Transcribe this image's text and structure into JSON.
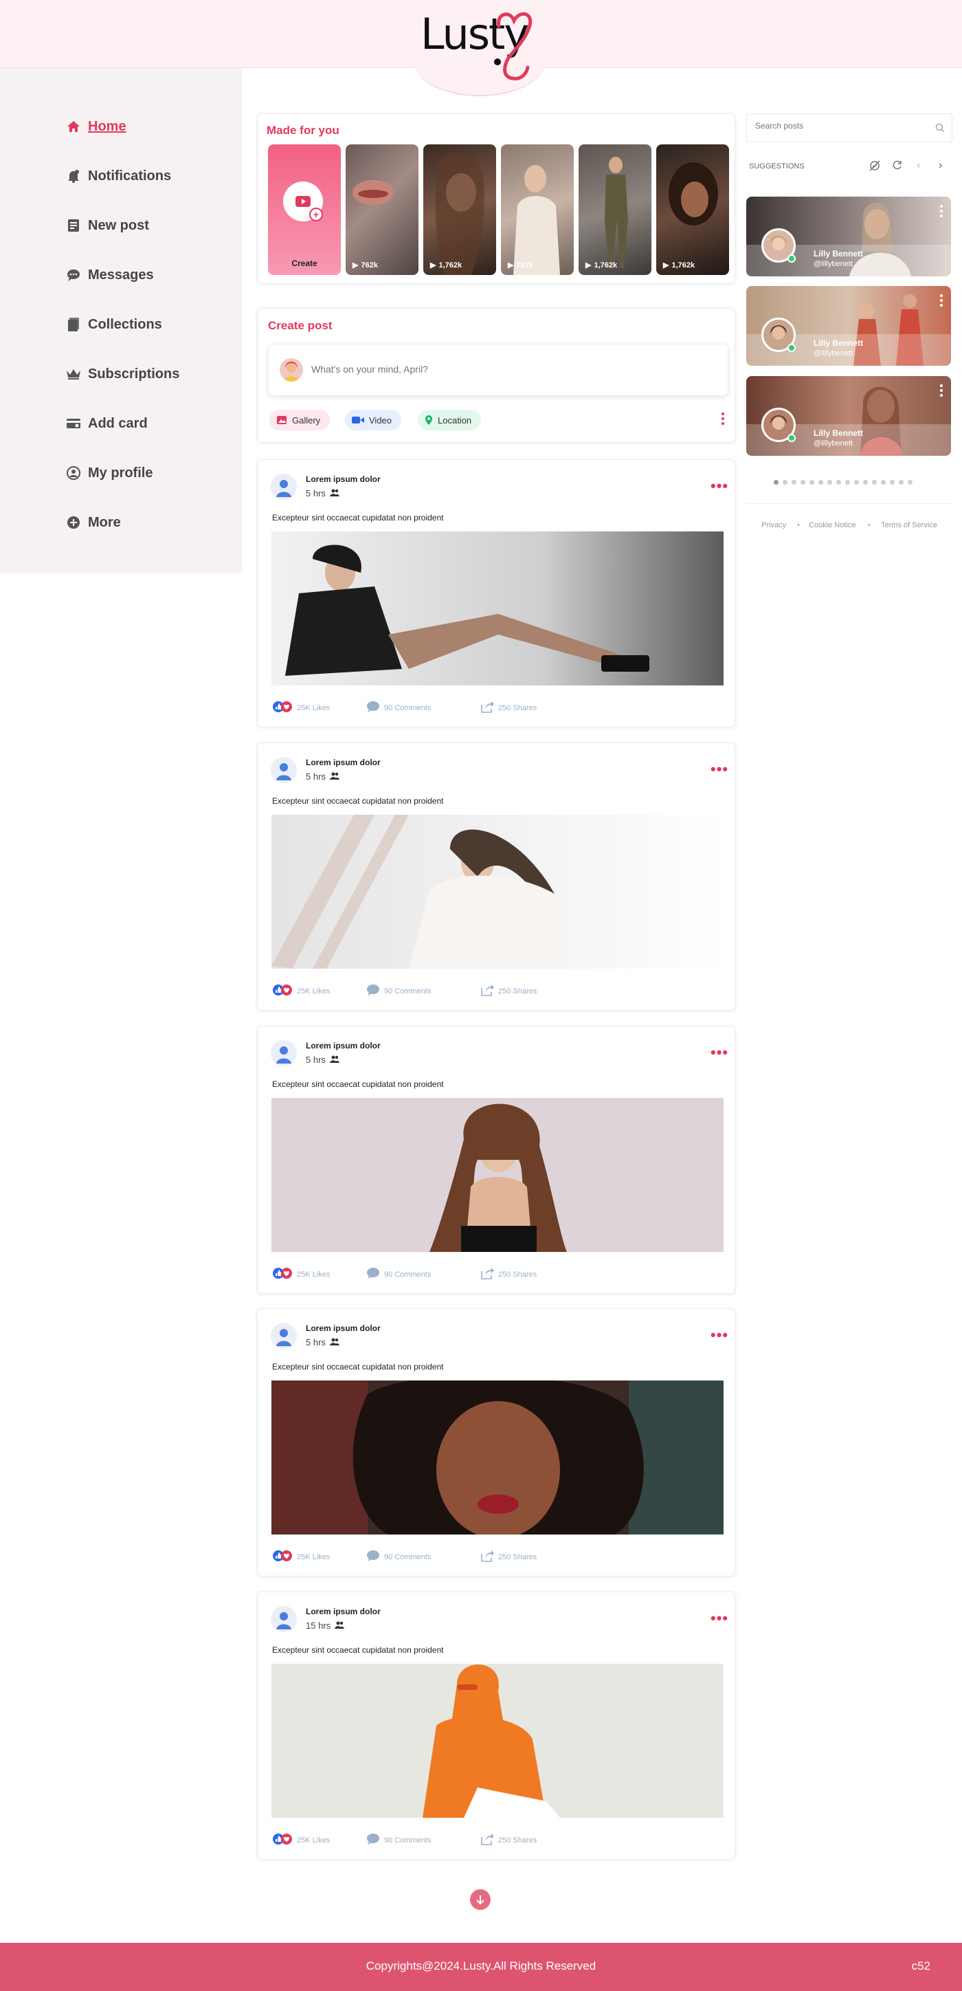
{
  "app": {
    "logo_text": "Lusty"
  },
  "sidebar": {
    "items": [
      {
        "label": "Home",
        "icon": "home-icon",
        "active": true
      },
      {
        "label": "Notifications",
        "icon": "bell-icon"
      },
      {
        "label": "New post",
        "icon": "new-post-icon"
      },
      {
        "label": "Messages",
        "icon": "chat-icon"
      },
      {
        "label": "Collections",
        "icon": "collections-icon"
      },
      {
        "label": "Subscriptions",
        "icon": "crown-icon"
      },
      {
        "label": "Add card",
        "icon": "card-icon"
      },
      {
        "label": "My profile",
        "icon": "profile-icon"
      },
      {
        "label": "More",
        "icon": "more-icon"
      }
    ]
  },
  "stories": {
    "title": "Made for you",
    "create_label": "Create",
    "items": [
      {
        "count": "762k"
      },
      {
        "count": "1,762k"
      },
      {
        "count": "762k"
      },
      {
        "count": "1,762k"
      },
      {
        "count": "1,762k"
      }
    ]
  },
  "create_post": {
    "title": "Create post",
    "placeholder": "What's on your mind, April?",
    "chips": [
      {
        "label": "Gallery",
        "icon": "gallery-icon"
      },
      {
        "label": "Video",
        "icon": "video-icon"
      },
      {
        "label": "Location",
        "icon": "location-icon"
      }
    ]
  },
  "posts": [
    {
      "author": "Lorem ipsum dolor",
      "time": "5 hrs",
      "text": "Excepteur sint occaecat cupidatat non proident",
      "likes": "25K Likes",
      "comments": "90 Comments",
      "shares": "250 Shares"
    },
    {
      "author": "Lorem ipsum dolor",
      "time": "5 hrs",
      "text": "Excepteur sint occaecat cupidatat non proident",
      "likes": "25K Likes",
      "comments": "90 Comments",
      "shares": "250 Shares"
    },
    {
      "author": "Lorem ipsum dolor",
      "time": "5 hrs",
      "text": "Excepteur sint occaecat cupidatat non proident",
      "likes": "25K Likes",
      "comments": "90 Comments",
      "shares": "250 Shares"
    },
    {
      "author": "Lorem ipsum dolor",
      "time": "5 hrs",
      "text": "Excepteur sint occaecat cupidatat non proident",
      "likes": "25K Likes",
      "comments": "90 Comments",
      "shares": "250 Shares"
    },
    {
      "author": "Lorem ipsum dolor",
      "time": "15 hrs",
      "text": "Excepteur sint occaecat cupidatat non proident",
      "likes": "25K Likes",
      "comments": "90 Comments",
      "shares": "250 Shares"
    }
  ],
  "right": {
    "search_placeholder": "Search posts",
    "suggestions_title": "SUGGESTIONS",
    "suggestions": [
      {
        "name": "Lilly Bennett",
        "handle": "@lillybenett"
      },
      {
        "name": "Lilly Bennett",
        "handle": "@lillybenett"
      },
      {
        "name": "Lilly Bennett",
        "handle": "@lillybenett"
      }
    ],
    "legal": [
      "Privacy",
      "Cookie Notice",
      "Terms of Service"
    ]
  },
  "footer": {
    "copyright": "Copyrights@2024.Lusty.All Rights Reserved",
    "code": "c52"
  },
  "colors": {
    "accent": "#e03a5c",
    "footer": "#dd5470",
    "header": "#fef1f4",
    "sidebar": "#f6f1f3"
  }
}
